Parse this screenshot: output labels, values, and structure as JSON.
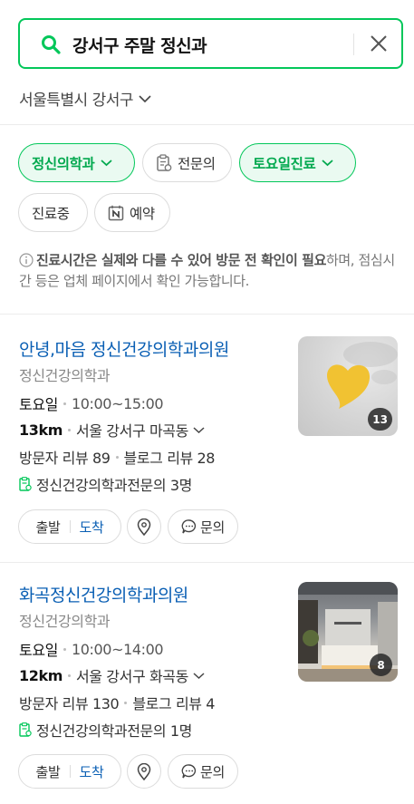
{
  "search": {
    "query": "강서구 주말 정신과",
    "icon": "search-icon",
    "clear_icon": "close-icon",
    "accent": "#03c75a"
  },
  "region": {
    "label": "서울특별시 강서구"
  },
  "filters": {
    "chips": [
      {
        "label": "정신의학과",
        "active": true
      },
      {
        "label": "전문의",
        "active": false
      },
      {
        "label": "토요일진료",
        "active": true
      },
      {
        "label": "진료중",
        "active": false
      },
      {
        "label": "예약",
        "active": false
      }
    ]
  },
  "notice": {
    "bold": "진료시간은 실제와 다를 수 있어 방문 전 확인이 필요",
    "rest": "하며, 점심시간 등은 업체 페이지에서 확인 가능합니다."
  },
  "results": [
    {
      "name": "안녕,마음 정신건강의학과의원",
      "category": "정신건강의학과",
      "day": "토요일",
      "hours": "10:00~15:00",
      "distance": "13km",
      "address": "서울 강서구 마곡동",
      "visitor_review": "방문자 리뷰 89",
      "blog_review": "블로그 리뷰 28",
      "specialists": "정신건강의학과전문의 3명",
      "photo_count": "13",
      "buttons": {
        "start": "출발",
        "arrive": "도착",
        "inquiry": "문의"
      }
    },
    {
      "name": "화곡정신건강의학과의원",
      "category": "정신건강의학과",
      "day": "토요일",
      "hours": "10:00~14:00",
      "distance": "12km",
      "address": "서울 강서구 화곡동",
      "visitor_review": "방문자 리뷰 130",
      "blog_review": "블로그 리뷰 4",
      "specialists": "정신건강의학과전문의 1명",
      "photo_count": "8",
      "buttons": {
        "start": "출발",
        "arrive": "도착",
        "inquiry": "문의"
      }
    }
  ],
  "colors": {
    "link": "#0a5fb4",
    "active_chip_bg": "#eafaf1",
    "active_chip_text": "#03a94f"
  }
}
